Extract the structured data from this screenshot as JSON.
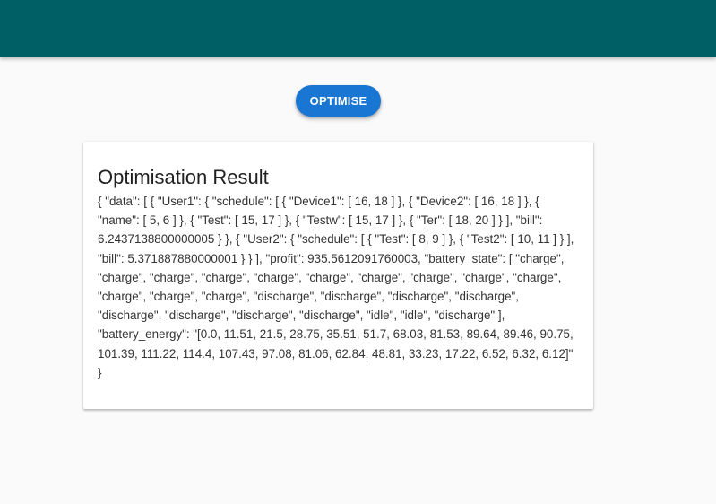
{
  "colors": {
    "app_bar": "#005f64",
    "primary_button": "#1976d2",
    "background": "#fafafa",
    "card": "#ffffff"
  },
  "toolbar": {
    "optimise_label": "OPTIMISE"
  },
  "result": {
    "title": "Optimisation Result",
    "body": "{ \"data\": [ { \"User1\": { \"schedule\": [ { \"Device1\": [ 16, 18 ] }, { \"Device2\": [ 16, 18 ] }, { \"name\": [ 5, 6 ] }, { \"Test\": [ 15, 17 ] }, { \"Testw\": [ 15, 17 ] }, { \"Ter\": [ 18, 20 ] } ], \"bill\": 6.2437138800000005 } }, { \"User2\": { \"schedule\": [ { \"Test\": [ 8, 9 ] }, { \"Test2\": [ 10, 11 ] } ], \"bill\": 5.371887880000001 } } ], \"profit\": 935.5612091760003, \"battery_state\": [ \"charge\", \"charge\", \"charge\", \"charge\", \"charge\", \"charge\", \"charge\", \"charge\", \"charge\", \"charge\", \"charge\", \"charge\", \"charge\", \"discharge\", \"discharge\", \"discharge\", \"discharge\", \"discharge\", \"discharge\", \"discharge\", \"discharge\", \"idle\", \"idle\", \"discharge\" ], \"battery_energy\": \"[0.0, 11.51, 21.5, 28.75, 35.51, 51.7, 68.03, 81.53, 89.64, 89.46, 90.75, 101.39, 111.22, 114.4, 107.43, 97.08, 81.06, 62.84, 48.81, 33.23, 17.22, 6.52, 6.32, 6.12]\" }"
  }
}
